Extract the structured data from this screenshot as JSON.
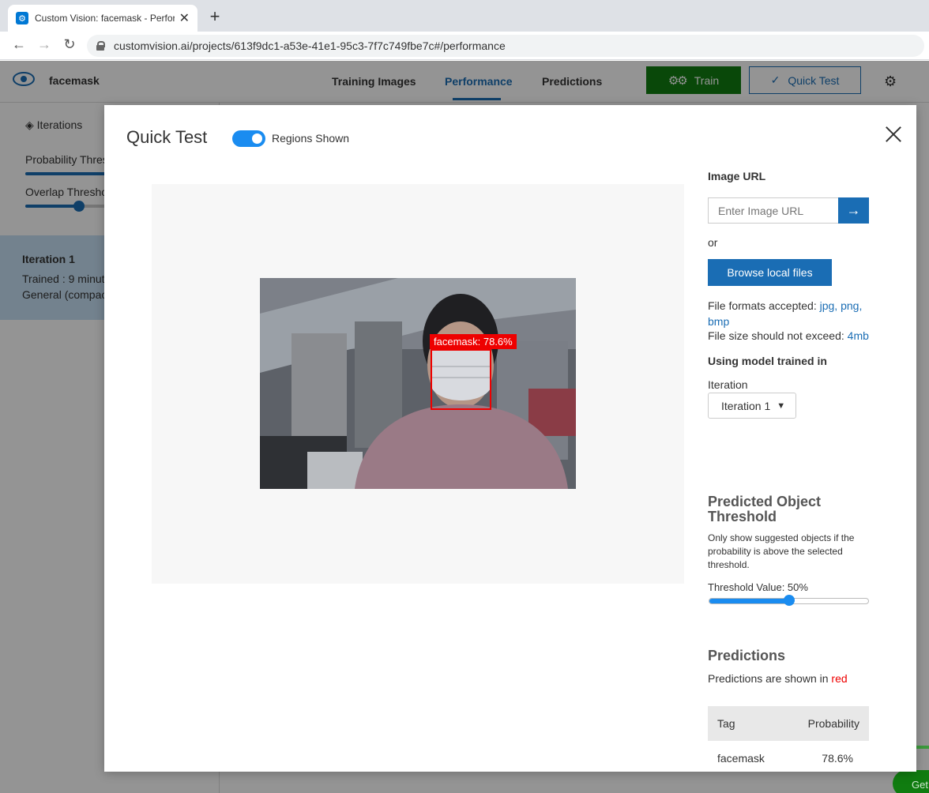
{
  "browser": {
    "tab_title": "Custom Vision: facemask - Perfor",
    "url": "customvision.ai/projects/613f9dc1-a53e-41e1-95c3-7f7c749fbe7c#/performance"
  },
  "header": {
    "project_name": "facemask",
    "tabs": [
      {
        "label": "Training Images"
      },
      {
        "label": "Performance"
      },
      {
        "label": "Predictions"
      }
    ],
    "active_tab": "Performance",
    "train_label": "Train",
    "quick_test_label": "Quick Test"
  },
  "sidebar": {
    "iterations_label": "Iterations",
    "probability_label": "Probability Thres",
    "overlap_label": "Overlap Thresho",
    "iteration_title": "Iteration 1",
    "trained_line": "Trained : 9 minut",
    "domain_line": "General (compac"
  },
  "modal": {
    "title": "Quick Test",
    "regions_toggle_label": "Regions Shown",
    "regions_shown": true,
    "detection": {
      "tag": "facemask",
      "label": "facemask: 78.6%",
      "color": "#e00000"
    },
    "image_url_heading": "Image URL",
    "image_url_placeholder": "Enter Image URL",
    "or_text": "or",
    "browse_label": "Browse local files",
    "formats_prefix": "File formats accepted: ",
    "formats_value": "jpg, png, bmp",
    "size_prefix": "File size should not exceed: ",
    "size_value": "4mb",
    "model_heading": "Using model trained in",
    "iteration_heading": "Iteration",
    "iteration_selected": "Iteration 1",
    "threshold_title": "Predicted Object Threshold",
    "threshold_desc": "Only show suggested objects if the probability is above the selected threshold.",
    "threshold_label": "Threshold Value: 50%",
    "threshold_value": 0.5,
    "predictions_title": "Predictions",
    "predictions_note_prefix": "Predictions are shown in ",
    "predictions_note_color": "red",
    "table": {
      "headers": [
        "Tag",
        "Probability"
      ],
      "rows": [
        {
          "tag": "facemask",
          "probability": "78.6%"
        }
      ]
    }
  },
  "colors": {
    "accent": "#1a6db4",
    "train_green": "#107c10",
    "toggle_blue": "#1a8cf0"
  }
}
